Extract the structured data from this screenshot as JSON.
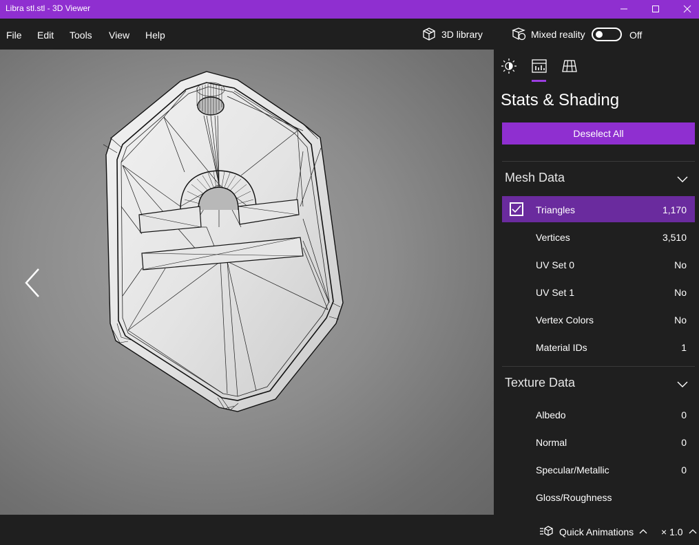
{
  "window": {
    "title": "Libra stl.stl - 3D Viewer",
    "minimize_icon": "minimize-icon",
    "maximize_icon": "maximize-icon",
    "close_icon": "close-icon",
    "accent_color": "#8f2fd0"
  },
  "menu": {
    "items": [
      {
        "label": "File"
      },
      {
        "label": "Edit"
      },
      {
        "label": "Tools"
      },
      {
        "label": "View"
      },
      {
        "label": "Help"
      }
    ],
    "library_label": "3D library",
    "library_icon": "cube-icon",
    "mixed_reality_label": "Mixed reality",
    "mixed_reality_icon": "mixed-reality-icon",
    "mixed_reality_state": "Off"
  },
  "viewport": {
    "nav_icon": "chevron-left-icon",
    "model_icon": "libra-pendant-wireframe"
  },
  "panel": {
    "tabs": [
      {
        "icon": "sun-icon",
        "selected": false
      },
      {
        "icon": "stats-icon",
        "selected": true
      },
      {
        "icon": "grid-icon",
        "selected": false
      }
    ],
    "title": "Stats & Shading",
    "deselect_label": "Deselect All",
    "mesh_section": {
      "title": "Mesh Data",
      "rows": [
        {
          "name": "Triangles",
          "value": "1,170",
          "checked": true
        },
        {
          "name": "Vertices",
          "value": "3,510"
        },
        {
          "name": "UV Set 0",
          "value": "No"
        },
        {
          "name": "UV Set 1",
          "value": "No"
        },
        {
          "name": "Vertex Colors",
          "value": "No"
        },
        {
          "name": "Material IDs",
          "value": "1"
        }
      ]
    },
    "texture_section": {
      "title": "Texture Data",
      "rows": [
        {
          "name": "Albedo",
          "value": "0"
        },
        {
          "name": "Normal",
          "value": "0"
        },
        {
          "name": "Specular/Metallic",
          "value": "0"
        },
        {
          "name": "Gloss/Roughness",
          "value": ""
        }
      ]
    }
  },
  "status": {
    "animations_icon": "animations-icon",
    "animations_label": "Quick Animations",
    "speed_label": "× 1.0"
  }
}
